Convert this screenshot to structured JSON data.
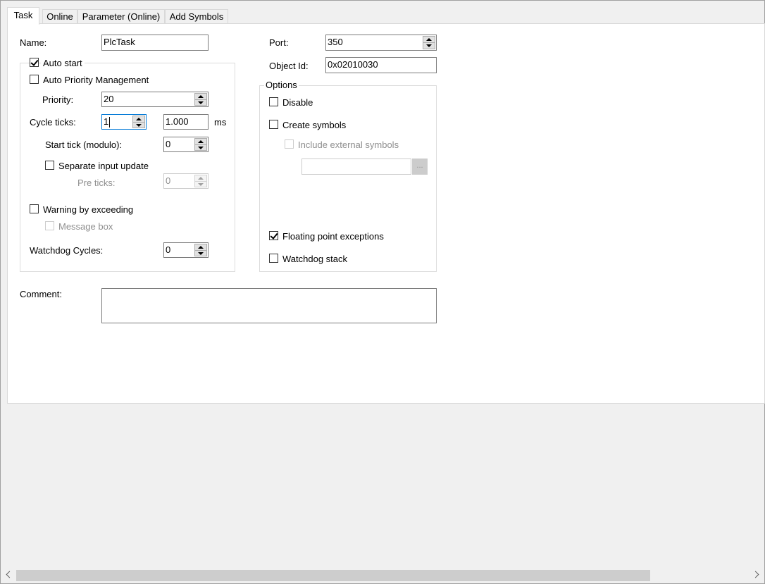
{
  "tabs": [
    "Task",
    "Online",
    "Parameter (Online)",
    "Add Symbols"
  ],
  "left": {
    "name_label": "Name:",
    "name_value": "PlcTask",
    "auto_start_label": "Auto start",
    "auto_start_checked": true,
    "auto_priority_label": "Auto Priority Management",
    "auto_priority_checked": false,
    "priority_label": "Priority:",
    "priority_value": "20",
    "cycle_ticks_label": "Cycle ticks:",
    "cycle_ticks_value": "1",
    "cycle_time_value": "1.000",
    "cycle_unit": "ms",
    "start_tick_label": "Start tick (modulo):",
    "start_tick_value": "0",
    "separate_input_label": "Separate input update",
    "separate_input_checked": false,
    "pre_ticks_label": "Pre ticks:",
    "pre_ticks_value": "0",
    "warning_label": "Warning by exceeding",
    "warning_checked": false,
    "message_box_label": "Message box",
    "message_box_checked": false,
    "watchdog_cycles_label": "Watchdog Cycles:",
    "watchdog_cycles_value": "0"
  },
  "right": {
    "port_label": "Port:",
    "port_value": "350",
    "object_id_label": "Object Id:",
    "object_id_value": "0x02010030",
    "options_title": "Options",
    "disable_label": "Disable",
    "disable_checked": false,
    "create_symbols_label": "Create symbols",
    "create_symbols_checked": false,
    "include_external_label": "Include external symbols",
    "include_external_checked": false,
    "external_path_value": "",
    "browse_label": "...",
    "floating_point_label": "Floating point exceptions",
    "floating_point_checked": true,
    "watchdog_stack_label": "Watchdog stack",
    "watchdog_stack_checked": false
  },
  "comment": {
    "label": "Comment:",
    "value": ""
  },
  "icons": {
    "spin": "spin-up-down-icon",
    "check": "check-icon",
    "scroll_left": "chevron-left-icon",
    "scroll_right": "chevron-right-icon"
  }
}
